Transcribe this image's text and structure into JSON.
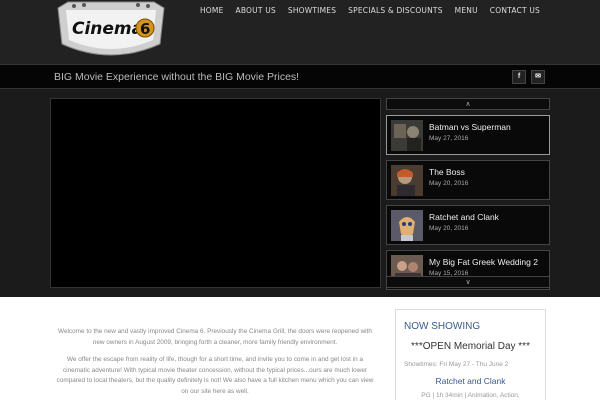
{
  "brand": {
    "logo_text": "Cinema",
    "logo_number": "6"
  },
  "nav": {
    "items": [
      "HOME",
      "ABOUT US",
      "SHOWTIMES",
      "SPECIALS & DISCOUNTS",
      "MENU",
      "CONTACT US"
    ]
  },
  "tagline": "BIG Movie Experience without the BIG Movie Prices!",
  "social": {
    "facebook": "f",
    "email": "✉"
  },
  "playlist": {
    "up": "∧",
    "down": "∨",
    "items": [
      {
        "title": "Batman vs Superman",
        "date": "May 27, 2016"
      },
      {
        "title": "The Boss",
        "date": "May 20, 2016"
      },
      {
        "title": "Ratchet and Clank",
        "date": "May 20, 2016"
      },
      {
        "title": "My Big Fat Greek Wedding 2",
        "date": "May 15, 2016"
      }
    ]
  },
  "intro": {
    "p1": "Welcome to the new and vastly improved Cinema 6. Previously the Cinema Grill, the doors were reopened with new owners in August 2009, bringing forth a cleaner, more family friendly environment.",
    "p2": "We offer the escape from reality of life, though for a short time, and invite you to come in and get lost in a cinematic adventure! With typical movie theater concession, without the typical prices...ours are much lower compared to local theaters, but the quality definitely is not! We also have a full kitchen menu which you can view on our site here as well."
  },
  "now_showing": {
    "title": "NOW SHOWING",
    "subtitle": "***OPEN Memorial Day ***",
    "dates": "Showtimes: Fri May 27 - Thu June 2",
    "movie": "Ratchet and Clank",
    "meta": "PG | 1h 34min | Animation, Action,"
  },
  "colors": {
    "accent": "#3a5a8c",
    "header_bg": "#222222",
    "tagbar_bg": "#050505"
  }
}
